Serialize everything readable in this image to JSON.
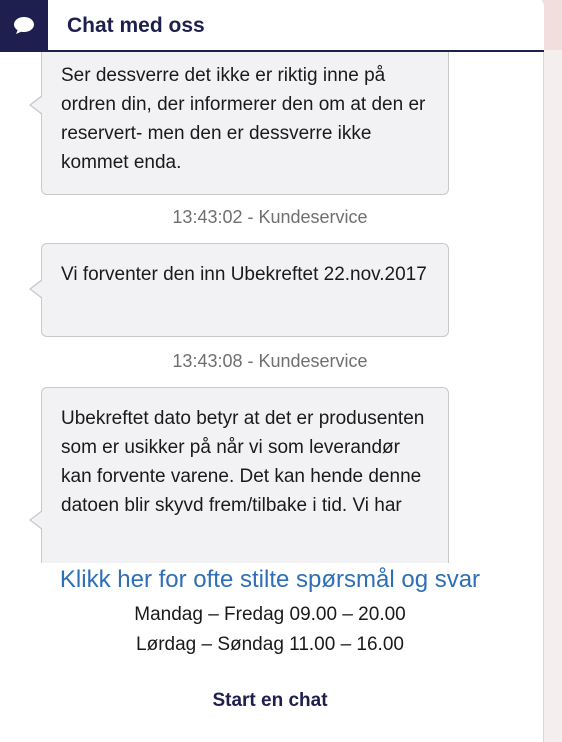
{
  "header": {
    "title": "Chat med oss",
    "icon": "chat-bubble-icon"
  },
  "messages": [
    {
      "text": "Ser dessverre det ikke er riktig inne på ordren din, der informerer den om at den er reservert- men den er dessverre ikke kommet enda."
    },
    {
      "timestamp": "13:43:02 - Kundeservice"
    },
    {
      "text": "Vi forventer den inn Ubekreftet 22.nov.2017"
    },
    {
      "timestamp": "13:43:08 - Kundeservice"
    },
    {
      "text": "Ubekreftet dato betyr at det er produsenten som er usikker på når vi som leverandør kan forvente varene. Det kan hende denne datoen blir skyvd frem/tilbake i tid. Vi har"
    }
  ],
  "footer": {
    "faq_link": "Klikk her for ofte stilte spørsmål og svar",
    "hours_weekday": "Mandag – Fredag 09.00 – 20.00",
    "hours_weekend": "Lørdag – Søndag 11.00 – 16.00",
    "start_chat": "Start en chat"
  },
  "colors": {
    "header_navy": "#1f1f4f",
    "link_blue": "#2e6fb5",
    "bubble_bg": "#f2f2f4",
    "timestamp_gray": "#6f6f6f"
  }
}
